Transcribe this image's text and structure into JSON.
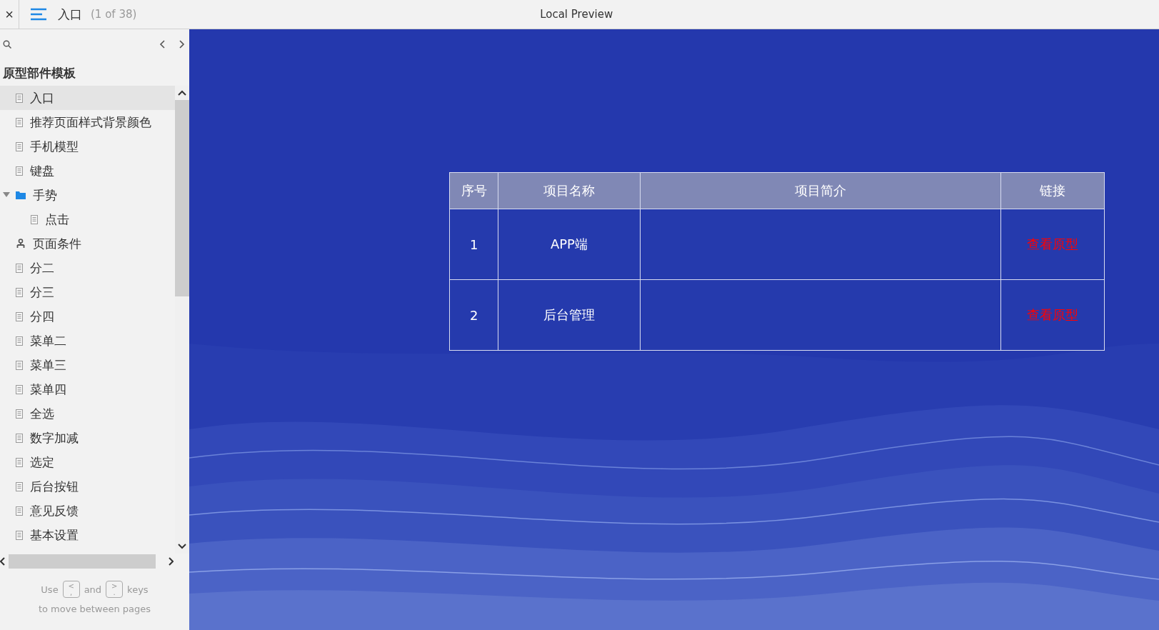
{
  "top_bar": {
    "close": "×",
    "page_title": "入口",
    "page_count": "(1 of 38)",
    "preview_title": "Local Preview"
  },
  "sidebar": {
    "section_title": "原型部件模板",
    "items": [
      {
        "label": "入口",
        "kind": "page",
        "selected": true
      },
      {
        "label": "推荐页面样式背景颜色",
        "kind": "page",
        "selected": false
      },
      {
        "label": "手机模型",
        "kind": "page",
        "selected": false
      },
      {
        "label": "键盘",
        "kind": "page",
        "selected": false
      },
      {
        "label": "手势",
        "kind": "folder",
        "selected": false,
        "expanded": true,
        "children": [
          {
            "label": "点击",
            "kind": "page",
            "selected": false
          }
        ]
      },
      {
        "label": "页面条件",
        "kind": "condition",
        "selected": false
      },
      {
        "label": "分二",
        "kind": "page",
        "selected": false
      },
      {
        "label": "分三",
        "kind": "page",
        "selected": false
      },
      {
        "label": "分四",
        "kind": "page",
        "selected": false
      },
      {
        "label": "菜单二",
        "kind": "page",
        "selected": false
      },
      {
        "label": "菜单三",
        "kind": "page",
        "selected": false
      },
      {
        "label": "菜单四",
        "kind": "page",
        "selected": false
      },
      {
        "label": "全选",
        "kind": "page",
        "selected": false
      },
      {
        "label": "数字加减",
        "kind": "page",
        "selected": false
      },
      {
        "label": "选定",
        "kind": "page",
        "selected": false
      },
      {
        "label": "后台按钮",
        "kind": "page",
        "selected": false
      },
      {
        "label": "意见反馈",
        "kind": "page",
        "selected": false
      },
      {
        "label": "基本设置",
        "kind": "page",
        "selected": false
      }
    ],
    "hint": {
      "use": "Use",
      "key_prev": {
        "top": "<",
        "bottom": ","
      },
      "and": "and",
      "key_next": {
        "top": ">",
        "bottom": "."
      },
      "keys": "keys",
      "line2": "to move between pages"
    }
  },
  "table": {
    "columns": [
      "序号",
      "项目名称",
      "项目简介",
      "链接"
    ],
    "rows": [
      {
        "number": "1",
        "name": "APP端",
        "link": "查看原型"
      },
      {
        "number": "2",
        "name": "后台管理",
        "link": "查看原型"
      }
    ]
  }
}
